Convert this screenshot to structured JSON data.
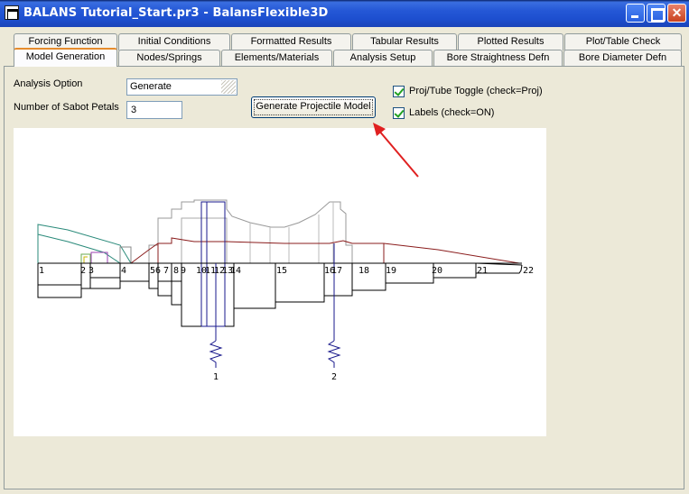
{
  "window": {
    "title": "BALANS Tutorial_Start.pr3 - BalansFlexible3D"
  },
  "tabs_row1": [
    {
      "label": "Forcing Function"
    },
    {
      "label": "Initial Conditions"
    },
    {
      "label": "Formatted Results"
    },
    {
      "label": "Tabular Results"
    },
    {
      "label": "Plotted Results"
    },
    {
      "label": "Plot/Table Check"
    }
  ],
  "tabs_row2": [
    {
      "label": "Model Generation",
      "active": true
    },
    {
      "label": "Nodes/Springs"
    },
    {
      "label": "Elements/Materials"
    },
    {
      "label": "Analysis Setup"
    },
    {
      "label": "Bore Straightness Defn"
    },
    {
      "label": "Bore Diameter Defn"
    }
  ],
  "form": {
    "analysis_option_label": "Analysis Option",
    "analysis_option_value": "Generate",
    "sabot_petals_label": "Number of Sabot Petals",
    "sabot_petals_value": "3",
    "generate_button_label": "Generate Projectile Model",
    "proj_tube_toggle_label": "Proj/Tube Toggle (check=Proj)",
    "proj_tube_toggle_checked": true,
    "labels_toggle_label": "Labels (check=ON)",
    "labels_toggle_checked": true
  },
  "diagram": {
    "node_labels": [
      "1",
      "2",
      "3",
      "4",
      "5",
      "6",
      "7",
      "8",
      "9",
      "10",
      "11",
      "12",
      "13",
      "14",
      "15",
      "16",
      "17",
      "18",
      "19",
      "20",
      "21",
      "22"
    ],
    "spring_labels": [
      "1",
      "2"
    ],
    "annotation_arrow_color": "#e02020",
    "spring_color": "#1a1a8c"
  }
}
